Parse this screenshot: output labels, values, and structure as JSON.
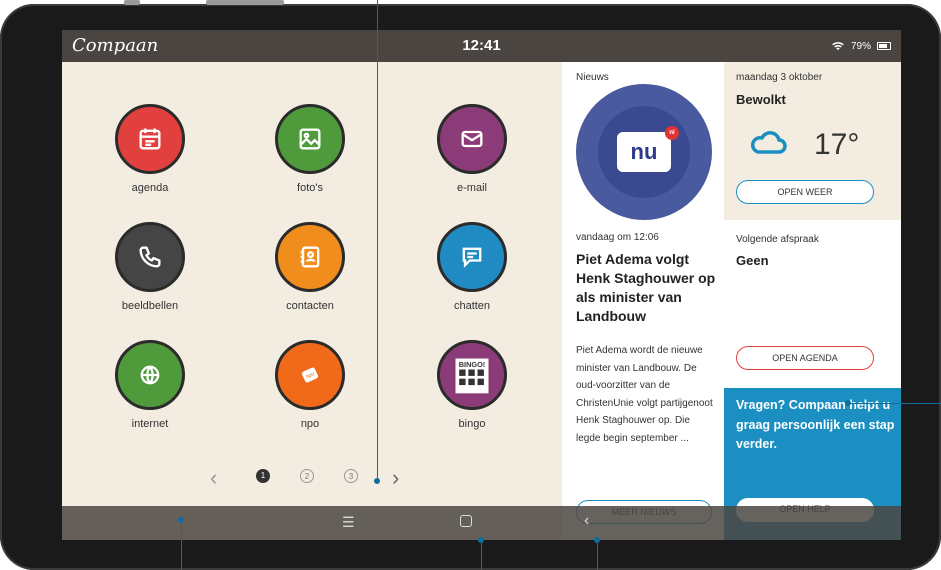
{
  "status_bar": {
    "logo": "Compaan",
    "time": "12:41",
    "battery": "79%"
  },
  "apps": [
    {
      "label": "agenda",
      "color": "#e2403f",
      "icon": "calendar-icon"
    },
    {
      "label": "foto's",
      "color": "#4f9b3c",
      "icon": "image-icon"
    },
    {
      "label": "e-mail",
      "color": "#8b3c78",
      "icon": "mail-icon"
    },
    {
      "label": "beeldbellen",
      "color": "#454545",
      "icon": "phone-icon"
    },
    {
      "label": "contacten",
      "color": "#f18d1c",
      "icon": "contacts-icon"
    },
    {
      "label": "chatten",
      "color": "#1f8bc2",
      "icon": "chat-icon"
    },
    {
      "label": "internet",
      "color": "#4f9b3c",
      "icon": "globe-icon"
    },
    {
      "label": "npo",
      "color": "#f06a1a",
      "icon": "npo-icon"
    },
    {
      "label": "bingo",
      "color": "#8b3c78",
      "icon": "bingo-icon"
    }
  ],
  "pager": {
    "pages": [
      "1",
      "2",
      "3"
    ],
    "active": 1
  },
  "news": {
    "section": "Nieuws",
    "logo_text": "nu",
    "logo_badge": "nl",
    "timestamp": "vandaag om 12:06",
    "headline": "Piet Adema volgt Henk Staghouwer op als minister van Landbouw",
    "body": "Piet Adema wordt de nieuwe minister van Landbouw. De oud-voorzitter van de ChristenUnie volgt partijgenoot Henk Staghouwer op. Die legde begin september ...",
    "button": "MEER NIEUWS"
  },
  "weather": {
    "date": "maandag 3 oktober",
    "condition": "Bewolkt",
    "temperature": "17°",
    "button": "OPEN WEER",
    "icon": "cloud-icon"
  },
  "appointment": {
    "title": "Volgende afspraak",
    "value": "Geen",
    "button": "OPEN AGENDA"
  },
  "help": {
    "text": "Vragen? Compaan helpt u graag persoonlijk een stap verder.",
    "button": "OPEN HELP"
  },
  "colors": {
    "accent_blue": "#1b8fc1",
    "panel_bg": "#f3ece1",
    "red_outline": "#e2403f",
    "blue_outline": "#1b8fc1"
  }
}
